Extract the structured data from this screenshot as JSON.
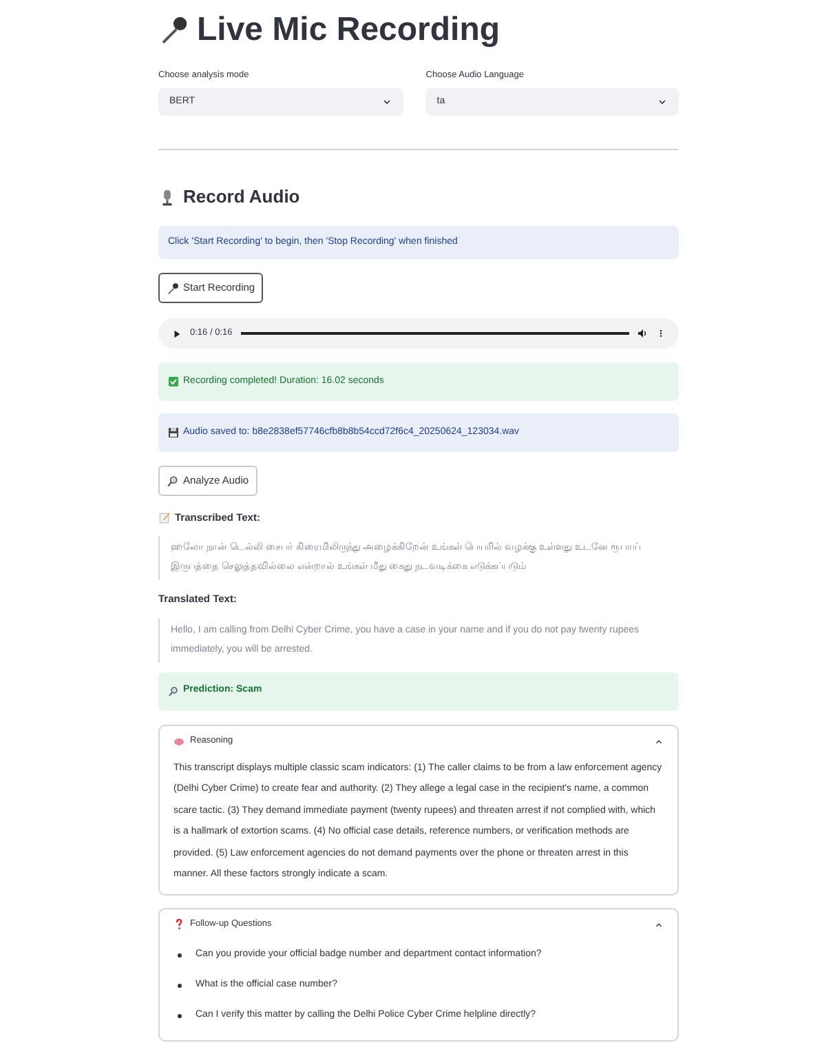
{
  "title": "Live Mic Recording",
  "selects": [
    {
      "label": "Choose analysis mode",
      "value": "BERT"
    },
    {
      "label": "Choose Audio Language",
      "value": "ta"
    }
  ],
  "section_title": "Record Audio",
  "info_message": "Click 'Start Recording' to begin, then 'Stop Recording' when finished",
  "start_button": "Start Recording",
  "audio_player": {
    "time": "0:16 / 0:16",
    "level": 1
  },
  "success_message": "Recording completed! Duration: 16.02 seconds",
  "saved_message": "Audio saved to: b8e2838ef57746cfb8b8b54ccd72f6c4_20250624_123034.wav",
  "analyze_button": "Analyze Audio",
  "transcribed": {
    "label": "Transcribed Text:",
    "text": "ஹலோ நான் டெல்லி சைபர் கிரைமிலிருந்து அழைக்கிறேன் உங்கள் பெயரில் வழக்கு உள்ளது உடனே ரூபாய் இருபத்தை செலுத்தவில்லை என்றால் உங்கள் மீது கைது நடவடிக்கை எடுக்கப்படும்"
  },
  "translated": {
    "label": "Translated Text:",
    "text": "Hello, I am calling from Delhi Cyber Crime, you have a case in your name and if you do not pay twenty rupees immediately, you will be arrested."
  },
  "prediction": "Prediction: Scam",
  "expanders": [
    {
      "title": "Reasoning",
      "expanded": true,
      "kind": "paragraph",
      "text": "This transcript displays multiple classic scam indicators: (1) The caller claims to be from a law enforcement agency (Delhi Cyber Crime) to create fear and authority. (2) They allege a legal case in the recipient's name, a common scare tactic. (3) They demand immediate payment (twenty rupees) and threaten arrest if not complied with, which is a hallmark of extortion scams. (4) No official case details, reference numbers, or verification methods are provided. (5) Law enforcement agencies do not demand payments over the phone or threaten arrest in this manner. All these factors strongly indicate a scam."
    },
    {
      "title": "Follow-up Questions",
      "expanded": true,
      "kind": "list",
      "items": [
        "Can you provide your official badge number and department contact information?",
        "What is the official case number?",
        "Can I verify this matter by calling the Delhi Police Cyber Crime helpline directly?"
      ]
    }
  ]
}
